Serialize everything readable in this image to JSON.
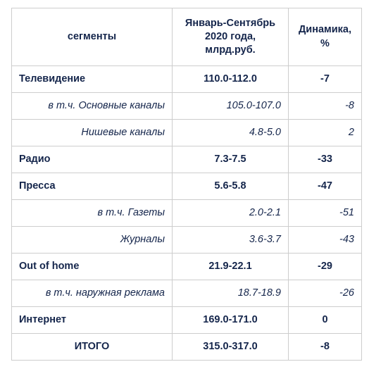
{
  "table": {
    "headers": {
      "segment": "сегменты",
      "value": "Январь-Сентябрь 2020 года, млрд.руб.",
      "value_line1": "Январь-Сентябрь",
      "value_line2": "2020 года,",
      "value_line3": "млрд.руб.",
      "dynamics_line1": "Динамика,",
      "dynamics_line2": "%"
    },
    "rows": [
      {
        "segment": "Телевидение",
        "value": "110.0-112.0",
        "dynamics": "-7",
        "style": "main"
      },
      {
        "segment": "в т.ч. Основные каналы",
        "value": "105.0-107.0",
        "dynamics": "-8",
        "style": "sub"
      },
      {
        "segment": "Нишевые каналы",
        "value": "4.8-5.0",
        "dynamics": "2",
        "style": "sub"
      },
      {
        "segment": "Радио",
        "value": "7.3-7.5",
        "dynamics": "-33",
        "style": "main"
      },
      {
        "segment": "Пресса",
        "value": "5.6-5.8",
        "dynamics": "-47",
        "style": "main"
      },
      {
        "segment": "в т.ч. Газеты",
        "value": "2.0-2.1",
        "dynamics": "-51",
        "style": "sub"
      },
      {
        "segment": "Журналы",
        "value": "3.6-3.7",
        "dynamics": "-43",
        "style": "sub"
      },
      {
        "segment": "Out of home",
        "value": "21.9-22.1",
        "dynamics": "-29",
        "style": "main"
      },
      {
        "segment": "в т.ч. наружная реклама",
        "value": "18.7-18.9",
        "dynamics": "-26",
        "style": "sub"
      },
      {
        "segment": "Интернет",
        "value": "169.0-171.0",
        "dynamics": "0",
        "style": "main"
      },
      {
        "segment": "ИТОГО",
        "value": "315.0-317.0",
        "dynamics": "-8",
        "style": "total"
      }
    ],
    "colors": {
      "text": "#14254b",
      "border": "#cdcdcd",
      "background": "#ffffff"
    }
  }
}
